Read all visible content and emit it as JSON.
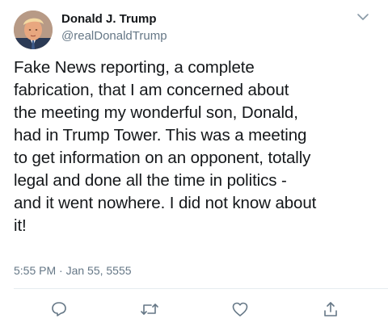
{
  "tweet": {
    "author": {
      "name": "Donald J. Trump",
      "handle": "@realDonaldTrump"
    },
    "text_lines": [
      "Fake News reporting, a complete",
      "fabrication, that I am concerned about",
      "the meeting my wonderful son, Donald,",
      "had in Trump Tower. This was a meeting",
      "to get information on an opponent, totally",
      "legal and done all the time in politics -",
      "and it went nowhere. I did not know about",
      "it!"
    ],
    "timestamp": "5:55 PM · Jan 55, 5555"
  },
  "icons": {
    "caret": "chevron-down-icon",
    "reply": "reply-icon",
    "retweet": "retweet-icon",
    "like": "heart-icon",
    "share": "share-icon"
  },
  "colors": {
    "text": "#14171a",
    "secondary": "#657786",
    "icon": "#657786",
    "divider": "#e6ecf0"
  }
}
